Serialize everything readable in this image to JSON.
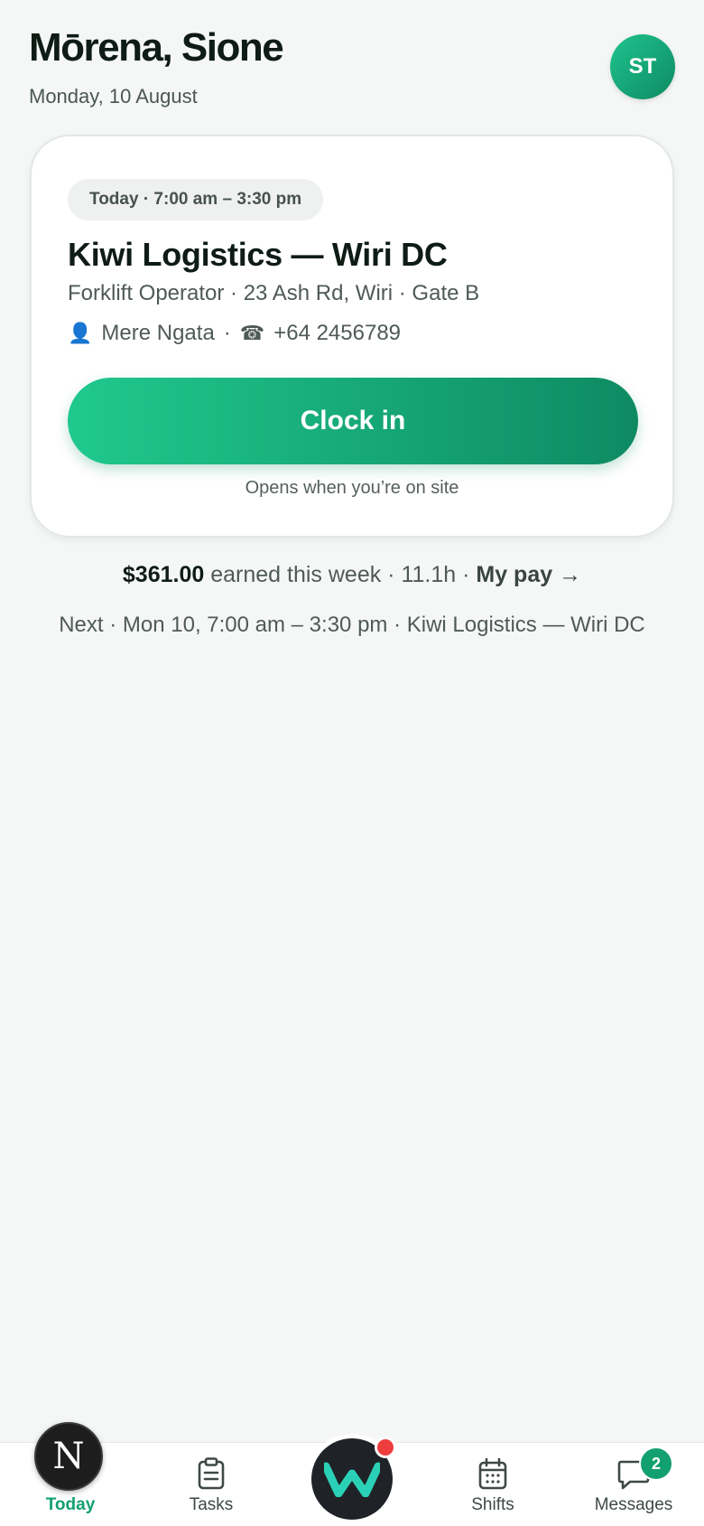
{
  "header": {
    "greeting": "Mōrena, Sione",
    "date": "Monday, 10 August",
    "avatar_initials": "ST"
  },
  "shift_card": {
    "time_pill": "Today · 7:00 am – 3:30 pm",
    "site": "Kiwi Logistics — Wiri DC",
    "details": "Forklift Operator · 23 Ash Rd, Wiri · Gate B",
    "contact_icon": "person-icon",
    "contact_name": "Mere Ngata",
    "separator": "·",
    "phone_icon": "phone-icon",
    "phone": "+64 2456789",
    "clock_in_label": "Clock in",
    "note": "Opens when you’re on site"
  },
  "earnings": {
    "amount": "$361.00",
    "text": " earned this week · 11.1h · ",
    "link": "My pay →"
  },
  "next_shift": "Next · Mon 10, 7:00 am – 3:30 pm · Kiwi Logistics — Wiri DC",
  "tabbar": {
    "today": "Today",
    "tasks": "Tasks",
    "shifts": "Shifts",
    "messages": "Messages",
    "messages_badge": "2",
    "today_avatar_letter": "N",
    "accent_color": "#12a06f"
  }
}
